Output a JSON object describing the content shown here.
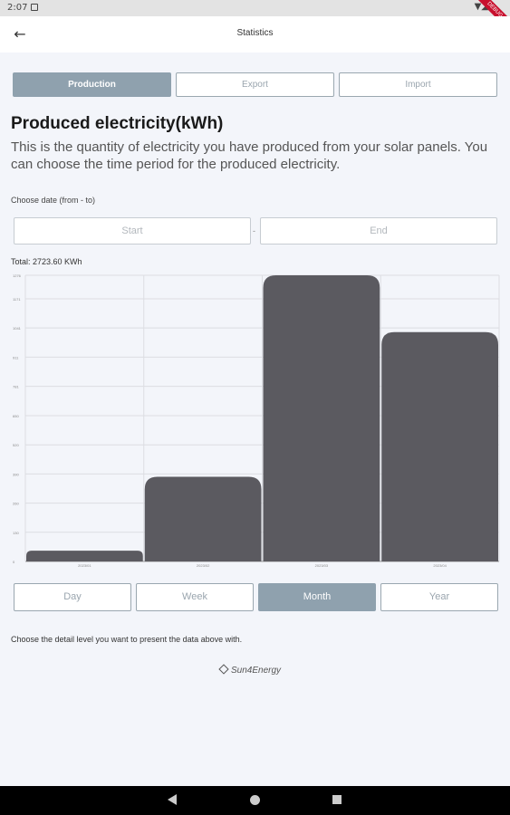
{
  "status": {
    "time": "2:07",
    "right_icons": "▼◢"
  },
  "debug_banner": "DEBUG",
  "app_bar": {
    "title": "Statistics",
    "back_icon": "back-arrow-icon"
  },
  "tabs": [
    {
      "label": "Production",
      "active": true
    },
    {
      "label": "Export",
      "active": false
    },
    {
      "label": "Import",
      "active": false
    }
  ],
  "heading": "Produced electricity(kWh)",
  "description": "This is the quantity of electricity you have produced from your solar panels. You can choose the time period for the  produced electricity.",
  "date_section": {
    "label": "Choose date (from - to)",
    "start_placeholder": "Start",
    "separator": "-",
    "end_placeholder": "End"
  },
  "total": "Total: 2723.60 KWh",
  "chart_data": {
    "type": "bar",
    "categories": [
      "2023/01",
      "2023/02",
      "2023/03",
      "2023/04"
    ],
    "values": [
      47.8,
      377.4,
      1275.9,
      1022.5
    ],
    "ylim": [
      0,
      1275.9
    ],
    "y_ticks": [
      "0",
      "130",
      "260",
      "390",
      "520",
      "650",
      "781",
      "911",
      "1041",
      "1171",
      "1276"
    ],
    "bar_color": "#5b5a60",
    "grid": true
  },
  "detail_levels": [
    {
      "label": "Day",
      "active": false
    },
    {
      "label": "Week",
      "active": false
    },
    {
      "label": "Month",
      "active": true
    },
    {
      "label": "Year",
      "active": false
    }
  ],
  "hint": "Choose the detail level you want to present the data above with.",
  "logo": "Sun4Energy",
  "colors": {
    "accent": "#8fa1ae",
    "bar": "#5b5a60",
    "background": "#f3f5fa"
  }
}
